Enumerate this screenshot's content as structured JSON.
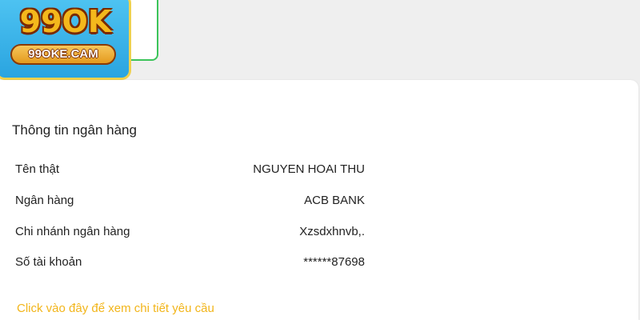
{
  "brand": {
    "logo_text": "99OK",
    "logo_domain": "99OKE.CAM"
  },
  "bank_info": {
    "title": "Thông tin ngân hàng",
    "rows": [
      {
        "label": "Tên thật",
        "value": "NGUYEN HOAI THU"
      },
      {
        "label": "Ngân hàng",
        "value": "ACB BANK"
      },
      {
        "label": "Chi nhánh ngân hàng",
        "value": "Xzsdxhnvb,."
      },
      {
        "label": "Số tài khoản",
        "value": "******87698"
      }
    ],
    "detail_link": "Click vào đây để xem chi tiết yêu cầu"
  },
  "colors": {
    "link": "#f2b51a",
    "logo_bg": "#2aa4e0",
    "logo_border": "#f1d14c",
    "green_outline": "#3cc45a"
  }
}
